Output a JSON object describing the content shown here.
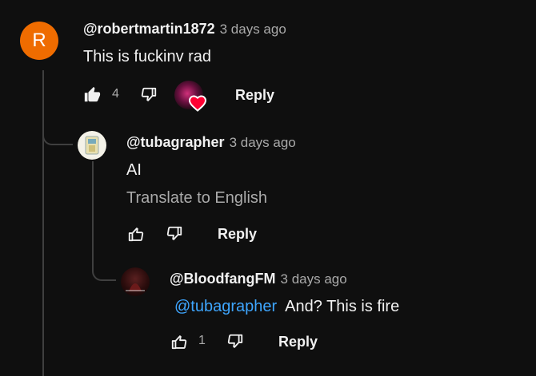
{
  "comments": [
    {
      "avatar_letter": "R",
      "handle": "@robertmartin1872",
      "time": "3 days ago",
      "text": "This is fuckinv rad",
      "like_count": "4",
      "reply_label": "Reply"
    },
    {
      "handle": "@tubagrapher",
      "time": "3 days ago",
      "text": "AI",
      "translate_label": "Translate to English",
      "reply_label": "Reply"
    },
    {
      "handle": "@BloodfangFM",
      "time": "3 days ago",
      "mention": "@tubagrapher",
      "text": "And? This is fire",
      "like_count": "1",
      "reply_label": "Reply"
    }
  ],
  "colors": {
    "background": "#0f0f0f",
    "avatar_orange": "#ef6c00",
    "mention_blue": "#3ea6ff",
    "heart_red": "#ff0033"
  }
}
